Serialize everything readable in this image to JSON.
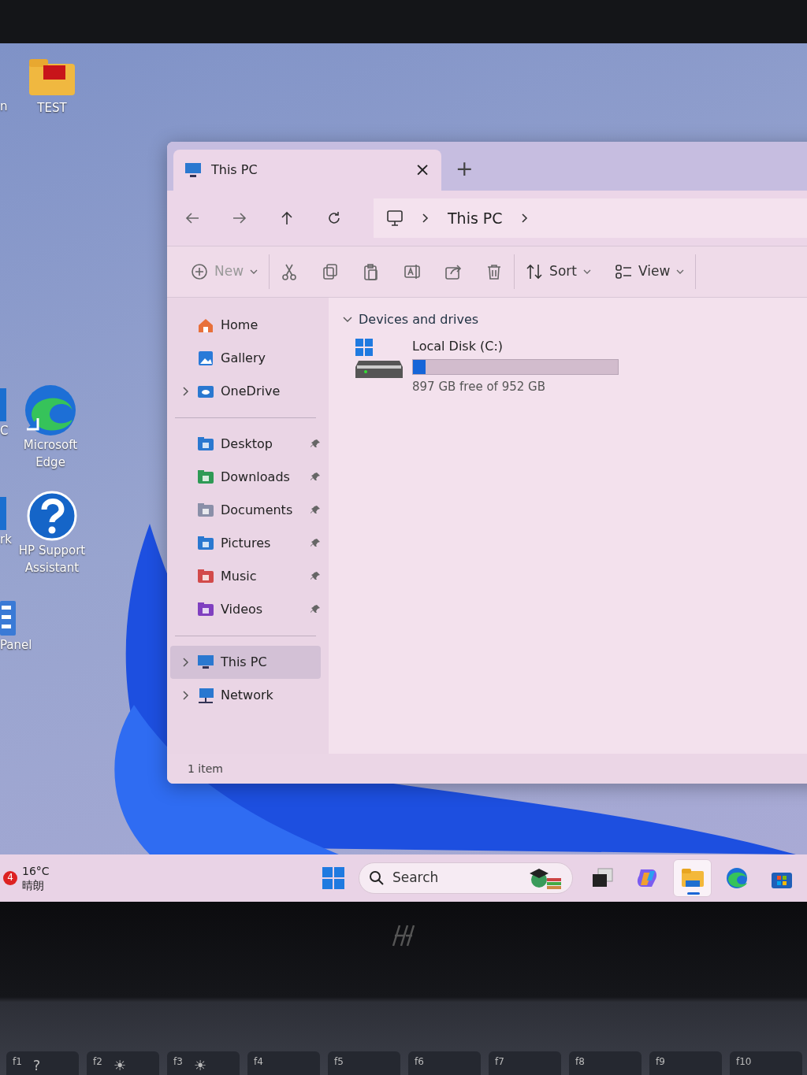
{
  "desktop": {
    "icons": [
      {
        "label": "n",
        "kind": "blank"
      },
      {
        "label": "TEST",
        "kind": "folder"
      },
      {
        "label": "C",
        "kind": "tile"
      },
      {
        "label": "Microsoft Edge",
        "kind": "edge"
      },
      {
        "label": "rk",
        "kind": "tile"
      },
      {
        "label": "HP Support Assistant",
        "kind": "help"
      },
      {
        "label": "Panel",
        "kind": "panel"
      }
    ]
  },
  "window": {
    "tabs": [
      {
        "title": "This PC",
        "selected": true,
        "close": "×"
      }
    ],
    "new_tab": "+",
    "address": {
      "crumbs": [
        "This PC"
      ]
    },
    "toolbar": [
      [
        {
          "kind": "new",
          "label": "New"
        }
      ],
      [
        {
          "kind": "cut"
        },
        {
          "kind": "copy"
        },
        {
          "kind": "paste"
        },
        {
          "kind": "rename"
        },
        {
          "kind": "share"
        },
        {
          "kind": "delete"
        }
      ],
      [
        {
          "kind": "sort",
          "label": "Sort"
        },
        {
          "kind": "view",
          "label": "View"
        }
      ]
    ],
    "sidebar": [
      [
        {
          "label": "Home",
          "kind": "home",
          "expandable": false,
          "pinned": false,
          "selected": false
        },
        {
          "label": "Gallery",
          "kind": "gallery",
          "expandable": false,
          "pinned": false,
          "selected": false
        },
        {
          "label": "OneDrive",
          "kind": "cloud",
          "expandable": true,
          "pinned": false,
          "selected": false
        }
      ],
      [
        {
          "label": "Desktop",
          "kind": "desktop",
          "expandable": false,
          "pinned": true,
          "selected": false
        },
        {
          "label": "Downloads",
          "kind": "downloads",
          "expandable": false,
          "pinned": true,
          "selected": false
        },
        {
          "label": "Documents",
          "kind": "documents",
          "expandable": false,
          "pinned": true,
          "selected": false
        },
        {
          "label": "Pictures",
          "kind": "pictures",
          "expandable": false,
          "pinned": true,
          "selected": false
        },
        {
          "label": "Music",
          "kind": "music",
          "expandable": false,
          "pinned": true,
          "selected": false
        },
        {
          "label": "Videos",
          "kind": "videos",
          "expandable": false,
          "pinned": true,
          "selected": false
        }
      ],
      [
        {
          "label": "This PC",
          "kind": "pc",
          "expandable": true,
          "pinned": false,
          "selected": true
        },
        {
          "label": "Network",
          "kind": "network",
          "expandable": true,
          "pinned": false,
          "selected": false
        }
      ]
    ],
    "section": {
      "title": "Devices and drives",
      "expanded": true
    },
    "drives": [
      {
        "name": "Local Disk (C:)",
        "level": 0.06,
        "free": "897 GB free of 952 GB"
      }
    ],
    "status_bar": "1 item"
  },
  "taskbar": {
    "weather": {
      "badge": "4",
      "temp": "16°C",
      "condition": "晴朗"
    },
    "apps": [
      {
        "kind": "start",
        "selected": false
      },
      {
        "kind": "search",
        "placeholder": "Search"
      },
      {
        "kind": "taskview",
        "selected": false
      },
      {
        "kind": "copilot",
        "selected": false
      },
      {
        "kind": "explorer",
        "selected": true
      },
      {
        "kind": "edge",
        "selected": false
      },
      {
        "kind": "store",
        "selected": false
      }
    ]
  },
  "keyboard": {
    "keys": [
      {
        "fn": "f1",
        "glyph": "?"
      },
      {
        "fn": "f2",
        "glyph": "☀"
      },
      {
        "fn": "f3",
        "glyph": "☀"
      },
      {
        "fn": "f4"
      },
      {
        "fn": "f5"
      },
      {
        "fn": "f6"
      },
      {
        "fn": "f7"
      },
      {
        "fn": "f8"
      },
      {
        "fn": "f9"
      },
      {
        "fn": "f10"
      }
    ]
  }
}
